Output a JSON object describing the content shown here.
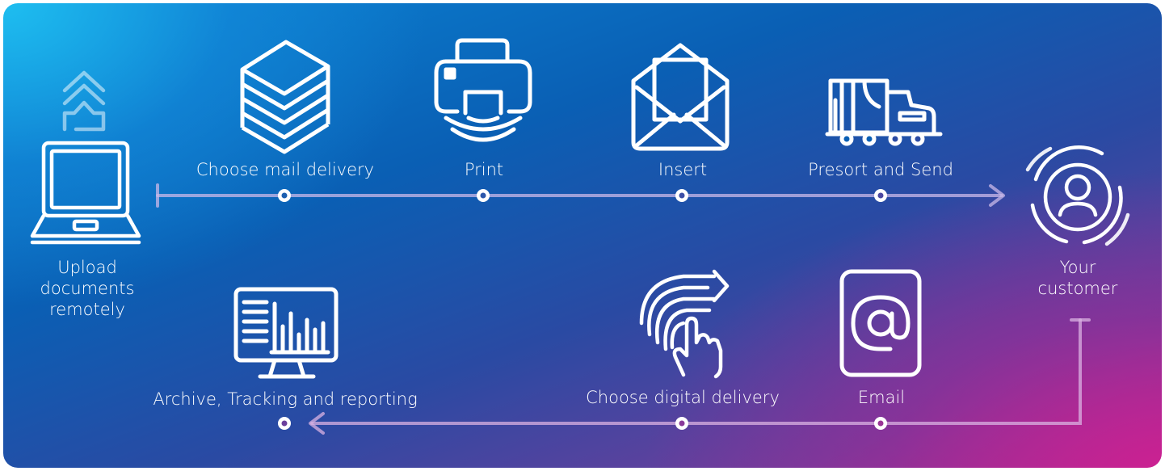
{
  "colors": {
    "background_start": "#0b86d6",
    "background_end": "#ce2092",
    "foreground": "#ffffff"
  },
  "source": {
    "icon": "laptop-upload-icon",
    "label_lines": [
      "Upload",
      "documents",
      "remotely"
    ]
  },
  "target": {
    "icon": "customer-icon",
    "label_lines": [
      "Your",
      "customer"
    ]
  },
  "mail_flow": {
    "steps": [
      {
        "label": "Choose mail delivery",
        "icon": "paper-stack-icon"
      },
      {
        "label": "Print",
        "icon": "printer-icon"
      },
      {
        "label": "Insert",
        "icon": "envelope-icon"
      },
      {
        "label": "Presort and Send",
        "icon": "delivery-truck-icon"
      }
    ]
  },
  "digital_flow": {
    "steps": [
      {
        "label": "Email",
        "icon": "email-at-icon"
      },
      {
        "label": "Choose digital delivery",
        "icon": "fingerprint-touch-icon"
      },
      {
        "label": "Archive, Tracking and reporting",
        "icon": "monitor-report-icon"
      }
    ]
  }
}
